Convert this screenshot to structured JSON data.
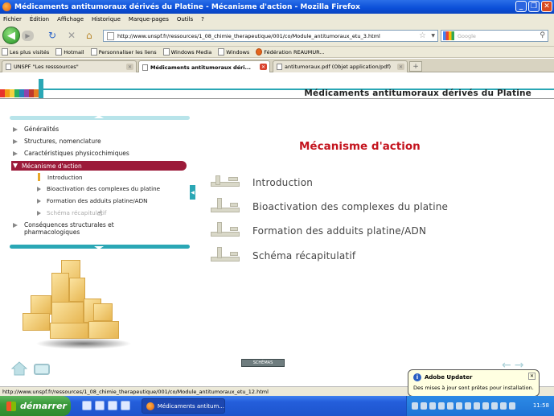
{
  "window": {
    "title": "Médicaments antitumoraux dérivés du Platine - Mécanisme d'action - Mozilla Firefox",
    "minimize": "_",
    "restore": "❐",
    "close": "✕"
  },
  "menubar": {
    "items": [
      "Fichier",
      "Édition",
      "Affichage",
      "Historique",
      "Marque-pages",
      "Outils",
      "?"
    ]
  },
  "navbar": {
    "url": "http://www.unspf.fr/ressources/1_08_chimie_therapeutique/001/co/Module_antitumoraux_etu_3.html",
    "search_placeholder": "Google"
  },
  "bookmarks": [
    "Les plus visités",
    "Hotmail",
    "Personnaliser les liens",
    "Windows Media",
    "Windows",
    "Fédération REAUMUR..."
  ],
  "tabs": [
    {
      "label": "UNSPF \"Les resssources\""
    },
    {
      "label": "Médicaments antitumoraux déri..."
    },
    {
      "label": "antitumoraux.pdf (Objet application/pdf)"
    }
  ],
  "new_tab": "+",
  "page": {
    "header_title": "Médicaments antitumoraux dérivés du Platine",
    "main_title": "Mécanisme d'action",
    "stripe_colors": [
      "#e8332a",
      "#f39c12",
      "#f4d03f",
      "#27ae60",
      "#2980b9",
      "#8e44ad",
      "#c0392b",
      "#e67e22"
    ],
    "menu": {
      "items": [
        {
          "label": "Généralités"
        },
        {
          "label": "Structures, nomenclature"
        },
        {
          "label": "Caractéristiques physicochimiques"
        },
        {
          "label": "Mécanisme d'action"
        },
        {
          "label": "Conséquences structurales et pharmacologiques"
        }
      ],
      "subitems": [
        {
          "label": "Introduction"
        },
        {
          "label": "Bioactivation des complexes du platine"
        },
        {
          "label": "Formation des adduits platine/ADN"
        },
        {
          "label": "Schéma récapitulatif"
        }
      ]
    },
    "toc": [
      "Introduction",
      "Bioactivation des complexes du platine",
      "Formation des adduits platine/ADN",
      "Schéma récapitulatif"
    ],
    "schema_button": "SCHÉMAS",
    "accent_color": "#2aa7b5",
    "title_color": "#c4151f",
    "active_item_color": "#9c1b3a"
  },
  "statusbar": {
    "text": "http://www.unspf.fr/ressources/1_08_chimie_therapeutique/001/co/Module_antitumoraux_etu_12.html"
  },
  "balloon": {
    "title": "Adobe Updater",
    "message": "Des mises à jour sont prêtes pour installation.",
    "close": "✕"
  },
  "taskbar": {
    "start_label": "démarrer",
    "task_label": "Médicaments antitum...",
    "clock": "11:58"
  }
}
